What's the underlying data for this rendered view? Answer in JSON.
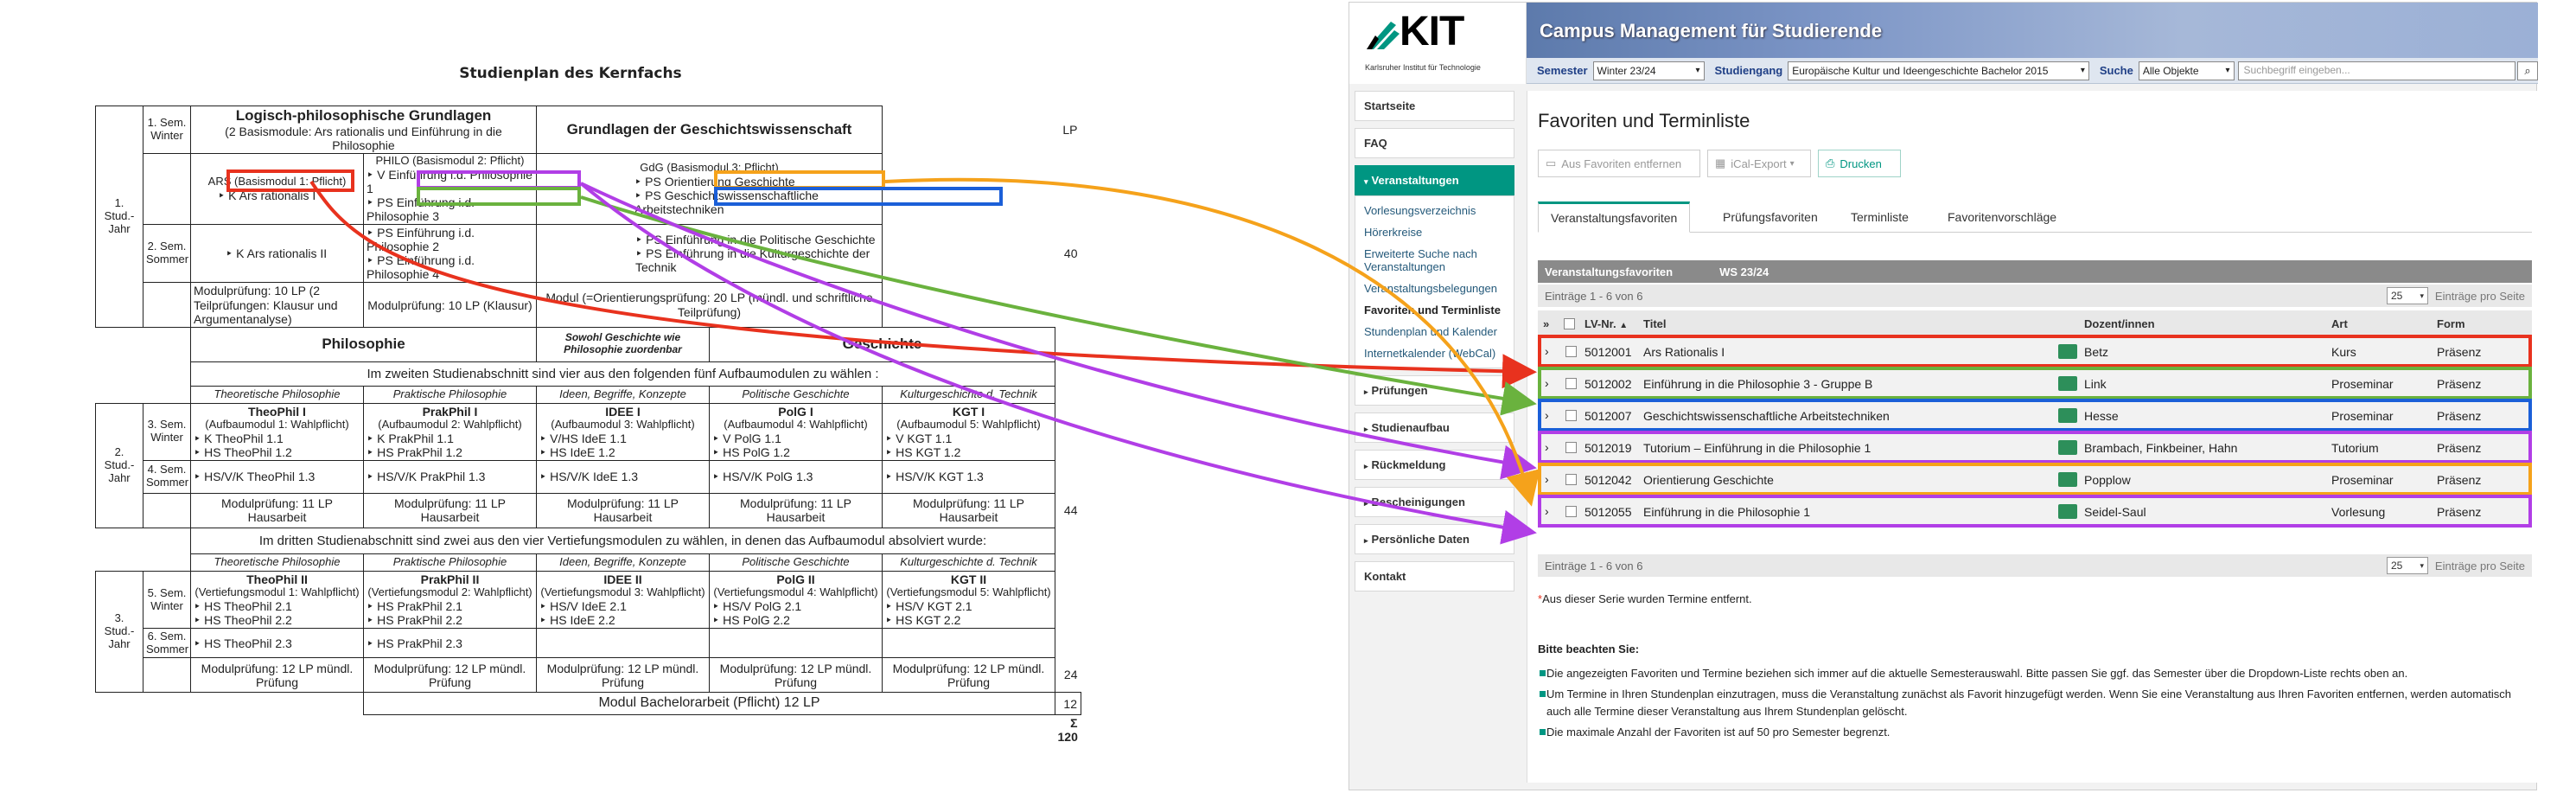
{
  "plan": {
    "title": "Studienplan des Kernfachs",
    "lp_head": "LP",
    "year1": "1. Stud.-Jahr",
    "sem1": "1. Sem. Winter",
    "sem2": "2. Sem. Sommer",
    "log_title": "Logisch-philosophische Grundlagen",
    "log_sub": "(2 Basismodule: Ars rationalis und Einführung in die Philosophie",
    "gesch_title": "Grundlagen der Geschichtswissenschaft",
    "ars_h": "ARS (Basismodul 1: Pflicht)",
    "ars1": "‣ K Ars rationalis I",
    "ars2": "‣ K Ars rationalis II",
    "philo_h": "PHILO (Basismodul 2: Pflicht)",
    "philo1": "‣ V Einführung i.d. Philosophie 1",
    "philo2": "‣ PS Einführung i.d. Philosophie 3",
    "philo3": "‣ PS Einführung i.d. Philosophie 2",
    "philo4": "‣ PS Einführung i.d. Philosophie 4",
    "gdg_h": "GdG (Basismodul 3: Pflicht)",
    "gdg1": "‣ PS Orientierung Geschichte",
    "gdg2": "‣ PS Geschichtswissenschaftliche Arbeitstechniken",
    "gdg3": "‣ PS Einführung in die Politische Geschichte",
    "gdg4": "‣ PS Einführung in die Kulturgeschichte der Technik",
    "mp1": "Modulprüfung: 10 LP (2 Teilprüfungen: Klausur und Argumentanalyse)",
    "mp2": "Modulprüfung: 10 LP (Klausur)",
    "mp3": "Modul (=Orientierungsprüfung: 20 LP (mündl. und schriftliche Teilprüfung)",
    "lp40": "40",
    "philosophie": "Philosophie",
    "sowohl": "Sowohl Geschichte wie Philosophie zuordenbar",
    "geschichte": "Geschichte",
    "zweiten": "Im zweiten Studienabschnitt sind vier aus den folgenden fünf Aufbaumodulen zu wählen :",
    "cols": [
      "Theoretische Philosophie",
      "Praktische Philosophie",
      "Ideen, Begriffe, Konzepte",
      "Politische Geschichte",
      "Kulturgeschichte d. Technik"
    ],
    "year2": "2. Stud.-Jahr",
    "sem3": "3. Sem. Winter",
    "sem4": "4. Sem. Sommer",
    "m2": [
      {
        "h": "TheoPhil I",
        "s": "(Aufbaumodul 1: Wahlpflicht)",
        "a": "‣ K       TheoPhil 1.1",
        "b": "‣ HS     TheoPhil 1.2",
        "c": "‣ HS/V/K  TheoPhil 1.3",
        "p": "Modulprüfung: 11 LP Hausarbeit"
      },
      {
        "h": "PrakPhil I",
        "s": "(Aufbaumodul 2: Wahlpflicht)",
        "a": "‣ K       PrakPhil 1.1",
        "b": "‣ HS     PrakPhil 1.2",
        "c": "‣ HS/V/K  PrakPhil 1.3",
        "p": "Modulprüfung: 11 LP Hausarbeit"
      },
      {
        "h": "IDEE I",
        "s": "(Aufbaumodul 3: Wahlpflicht)",
        "a": "‣ V/HS    IdeE 1.1",
        "b": "‣ HS      IdeE 1.2",
        "c": "‣ HS/V/K  IdeE 1.3",
        "p": "Modulprüfung: 11 LP Hausarbeit"
      },
      {
        "h": "PolG I",
        "s": "(Aufbaumodul 4: Wahlpflicht)",
        "a": "‣ V       PolG 1.1",
        "b": "‣ HS      PolG 1.2",
        "c": "‣ HS/V/K  PolG 1.3",
        "p": "Modulprüfung: 11 LP Hausarbeit"
      },
      {
        "h": "KGT I",
        "s": "(Aufbaumodul 5: Wahlpflicht)",
        "a": "‣ V       KGT 1.1",
        "b": "‣ HS      KGT 1.2",
        "c": "‣ HS/V/K  KGT 1.3",
        "p": "Modulprüfung: 11 LP Hausarbeit"
      }
    ],
    "lp44": "44",
    "dritten": "Im dritten Studienabschnitt sind zwei aus den vier Vertiefungsmodulen zu wählen, in denen das Aufbaumodul absolviert wurde:",
    "year3": "3. Stud.-Jahr",
    "sem5": "5. Sem. Winter",
    "sem6": "6. Sem. Sommer",
    "m3": [
      {
        "h": "TheoPhil II",
        "s": "(Vertiefungsmodul 1: Wahlpflicht)",
        "a": "‣ HS  TheoPhil 2.1",
        "b": "‣ HS  TheoPhil 2.2",
        "c": "‣ HS  TheoPhil 2.3",
        "p": "Modulprüfung: 12 LP mündl. Prüfung"
      },
      {
        "h": "PrakPhil II",
        "s": "(Vertiefungsmodul 2: Wahlpflicht)",
        "a": "‣ HS  PrakPhil 2.1",
        "b": "‣ HS  PrakPhil 2.2",
        "c": "‣ HS  PrakPhil 2.3",
        "p": "Modulprüfung: 12 LP mündl. Prüfung"
      },
      {
        "h": "IDEE II",
        "s": "(Vertiefungsmodul 3: Wahlpflicht)",
        "a": "‣ HS/V  IdeE 2.1",
        "b": "‣ HS    IdeE 2.2",
        "c": "",
        "p": "Modulprüfung: 12 LP mündl. Prüfung"
      },
      {
        "h": "PolG II",
        "s": "(Vertiefungsmodul 4: Wahlpflicht)",
        "a": "‣ HS/V  PolG 2.1",
        "b": "‣ HS    PolG 2.2",
        "c": "",
        "p": "Modulprüfung: 12 LP mündl. Prüfung"
      },
      {
        "h": "KGT II",
        "s": "(Vertiefungsmodul 5: Wahlpflicht)",
        "a": "‣ HS/V  KGT 2.1",
        "b": "‣ HS    KGT 2.2",
        "c": "",
        "p": "Modulprüfung: 12 LP mündl. Prüfung"
      }
    ],
    "lp24": "24",
    "bachelor": "Modul Bachelorarbeit (Pflicht) 12 LP",
    "lp12": "12",
    "sum": "Σ 120"
  },
  "app": {
    "brand": "KIT",
    "brand_sub": "Karlsruher Institut für Technologie",
    "title": "Campus Management für Studierende",
    "search": {
      "semester_label": "Semester",
      "semester": "Winter 23/24",
      "studiengang_label": "Studiengang",
      "studiengang": "Europäische Kultur und Ideengeschichte Bachelor 2015",
      "suche_label": "Suche",
      "objekte": "Alle Objekte",
      "placeholder": "Suchbegriff eingeben..."
    },
    "nav": {
      "startseite": "Startseite",
      "faq": "FAQ",
      "veranstaltungen": "Veranstaltungen",
      "sub": [
        "Vorlesungsverzeichnis",
        "Hörerkreise",
        "Erweiterte Suche nach Veranstaltungen",
        "Veranstaltungsbelegungen",
        "Favoriten und Terminliste",
        "Stundenplan und Kalender",
        "Internetkalender (WebCal)"
      ],
      "pruefungen": "Prüfungen",
      "studienaufbau": "Studienaufbau",
      "rueckmeldung": "Rückmeldung",
      "bescheinigungen": "Bescheinigungen",
      "persoenlich": "Persönliche Daten",
      "kontakt": "Kontakt"
    },
    "page_title": "Favoriten und Terminliste",
    "btn_remove": "Aus Favoriten entfernen",
    "btn_ical": "iCal-Export",
    "btn_print": "Drucken",
    "tabs": [
      "Veranstaltungsfavoriten",
      "Prüfungsfavoriten",
      "Terminliste",
      "Favoritenvorschläge"
    ],
    "table_title": "Veranstaltungsfavoriten",
    "table_sem": "WS 23/24",
    "entries": "Einträge 1 - 6 von 6",
    "per_page": "25",
    "per_page_label": "Einträge pro Seite",
    "cols": {
      "lvnr": "LV-Nr.",
      "titel": "Titel",
      "dozent": "Dozent/innen",
      "art": "Art",
      "form": "Form"
    },
    "rows": [
      {
        "nr": "5012001",
        "titel": "Ars Rationalis I",
        "dozent": "Betz",
        "art": "Kurs",
        "form": "Präsenz"
      },
      {
        "nr": "5012002",
        "titel": "Einführung in die Philosophie 3 - Gruppe B",
        "dozent": "Link",
        "art": "Proseminar",
        "form": "Präsenz"
      },
      {
        "nr": "5012007",
        "titel": "Geschichtswissenschaftliche Arbeitstechniken",
        "dozent": "Hesse",
        "art": "Proseminar",
        "form": "Präsenz"
      },
      {
        "nr": "5012019",
        "titel": "Tutorium – Einführung in die Philosophie 1",
        "dozent": "Brambach, Finkbeiner, Hahn",
        "art": "Tutorium",
        "form": "Präsenz"
      },
      {
        "nr": "5012042",
        "titel": "Orientierung Geschichte",
        "dozent": "Popplow",
        "art": "Proseminar",
        "form": "Präsenz"
      },
      {
        "nr": "5012055",
        "titel": "Einführung in die Philosophie 1",
        "dozent": "Seidel-Saul",
        "art": "Vorlesung",
        "form": "Präsenz"
      }
    ],
    "footnote": "Aus dieser Serie wurden Termine entfernt.",
    "bitte": "Bitte beachten Sie:",
    "bullets": [
      "Die angezeigten Favoriten und Termine beziehen sich immer auf die aktuelle Semesterauswahl. Bitte passen Sie ggf. das Semester über die Dropdown-Liste rechts oben an.",
      "Um Termine in Ihren Stundenplan einzutragen, muss die Veranstaltung zunächst als Favorit hinzugefügt werden. Wenn Sie eine Veranstaltung aus Ihren Favoriten entfernen, werden automatisch auch alle Termine dieser Veranstaltung aus Ihrem Stundenplan gelöscht.",
      "Die maximale Anzahl der Favoriten ist auf 50 pro Semester begrenzt."
    ]
  },
  "colors": {
    "red": "#e8321e",
    "green": "#6ab23e",
    "blue": "#1b5fd8",
    "purple": "#b13ee6",
    "orange": "#f5a21b",
    "kit_green": "#009682"
  }
}
